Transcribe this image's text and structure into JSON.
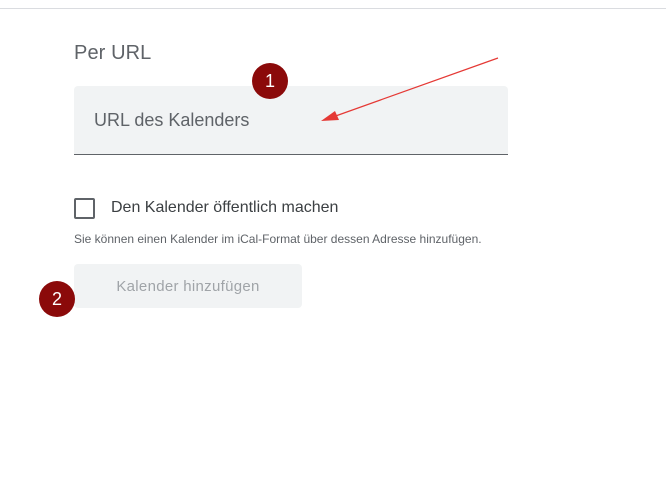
{
  "section": {
    "title": "Per URL"
  },
  "url_field": {
    "placeholder": "URL des Kalenders",
    "value": ""
  },
  "public_checkbox": {
    "label": "Den Kalender öffentlich machen",
    "checked": false
  },
  "helper_text": "Sie können einen Kalender im iCal-Format über dessen Adresse hinzufügen.",
  "add_button": {
    "label": "Kalender hinzufügen",
    "enabled": false
  },
  "annotations": {
    "badge_1": "1",
    "badge_2": "2"
  },
  "colors": {
    "field_background": "#f1f3f4",
    "badge_background": "#8b0a0a",
    "arrow": "#e53935",
    "disabled_text": "#a0a4a8"
  }
}
